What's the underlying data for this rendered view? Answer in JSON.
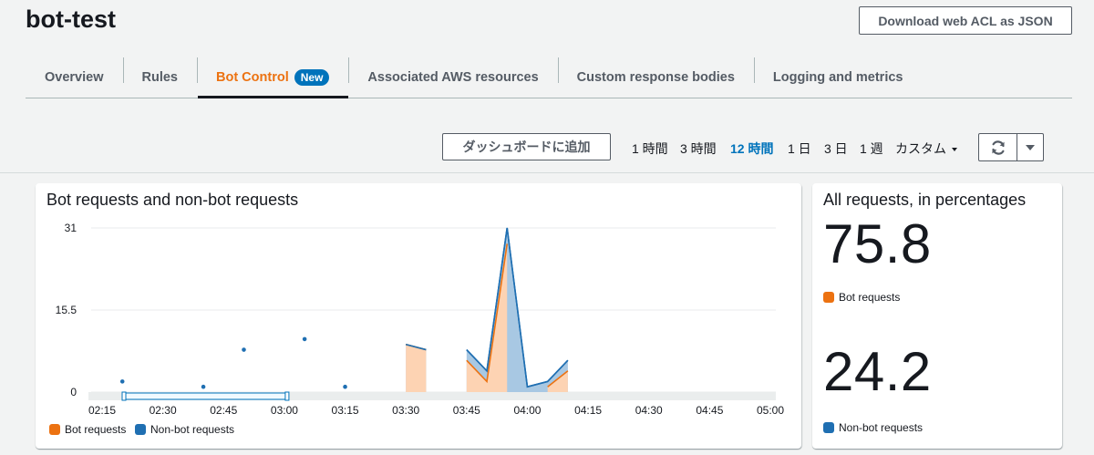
{
  "page": {
    "title": "bot-test",
    "download_label": "Download web ACL as JSON"
  },
  "tabs": [
    {
      "label": "Overview"
    },
    {
      "label": "Rules"
    },
    {
      "label": "Bot Control",
      "badge": "New",
      "active": true
    },
    {
      "label": "Associated AWS resources"
    },
    {
      "label": "Custom response bodies"
    },
    {
      "label": "Logging and metrics"
    }
  ],
  "toolbar": {
    "add_dashboard_label": "ダッシュボードに追加",
    "time_ranges": [
      {
        "label": "1 時間"
      },
      {
        "label": "3 時間"
      },
      {
        "label": "12 時間",
        "selected": true
      },
      {
        "label": "1 日"
      },
      {
        "label": "3 日"
      },
      {
        "label": "1 週"
      },
      {
        "label": "カスタム",
        "dropdown": true
      }
    ],
    "refresh_icon": "refresh-icon",
    "dropdown_icon": "caret-down-icon"
  },
  "colors": {
    "bot": "#ec7211",
    "bot_fill": "#fdd3b3",
    "nonbot": "#1f6fb2",
    "nonbot_fill": "#a8c8e3",
    "accent": "#0073bb"
  },
  "chart_card": {
    "title": "Bot requests and non-bot requests",
    "legend": [
      {
        "label": "Bot requests"
      },
      {
        "label": "Non-bot requests"
      }
    ]
  },
  "chart_data": {
    "type": "area",
    "title": "Bot requests and non-bot requests",
    "y_ticks": [
      "0",
      "15.5",
      "31"
    ],
    "ylim": [
      0,
      31
    ],
    "x_ticks": [
      "02:15",
      "02:30",
      "02:45",
      "03:00",
      "03:15",
      "03:30",
      "03:45",
      "04:00",
      "04:15",
      "04:30",
      "04:45",
      "05:00"
    ],
    "xlim": [
      "02:15",
      "05:00"
    ],
    "grid": true,
    "legend_position": "bottom-left",
    "series": [
      {
        "name": "Bot requests",
        "points": [
          [
            "03:30",
            9
          ],
          [
            "03:35",
            8
          ],
          [
            "03:45",
            6
          ],
          [
            "03:50",
            2
          ],
          [
            "03:55",
            28
          ],
          [
            "04:05",
            1
          ],
          [
            "04:10",
            4
          ]
        ]
      },
      {
        "name": "Non-bot requests",
        "points": [
          [
            "02:20",
            2
          ],
          [
            "02:40",
            1
          ],
          [
            "02:50",
            8
          ],
          [
            "03:05",
            10
          ],
          [
            "03:15",
            1
          ],
          [
            "03:30",
            9
          ],
          [
            "03:35",
            8
          ],
          [
            "03:45",
            8
          ],
          [
            "03:50",
            4
          ],
          [
            "03:55",
            31
          ],
          [
            "04:00",
            1
          ],
          [
            "04:05",
            2
          ],
          [
            "04:10",
            6
          ]
        ]
      }
    ]
  },
  "percent_card": {
    "title": "All requests, in percentages",
    "bot_value": "75.8",
    "bot_label": "Bot requests",
    "nonbot_value": "24.2",
    "nonbot_label": "Non-bot requests"
  }
}
